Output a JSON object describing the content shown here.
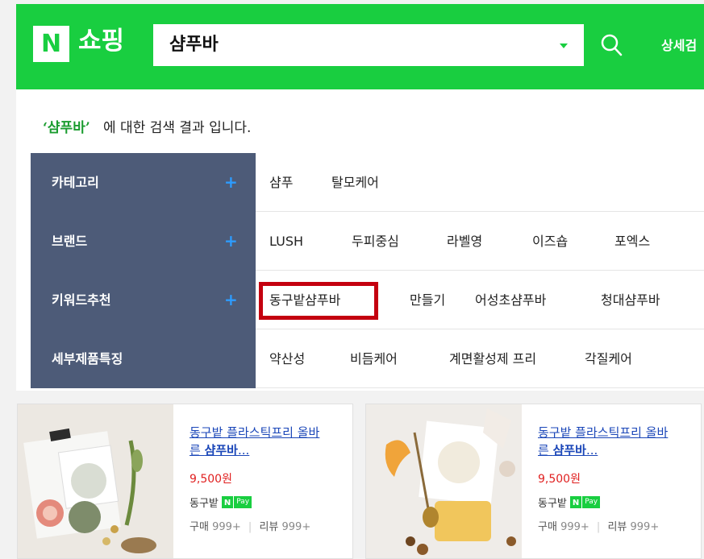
{
  "header": {
    "logo_letter": "N",
    "logo_text": "쇼핑",
    "search_value": "샴푸바",
    "detail_link": "상세검"
  },
  "result_message": {
    "keyword": "‘샴푸바’",
    "suffix": "에 대한 검색 결과 입니다."
  },
  "filter_rows": [
    {
      "label": "카테고리",
      "plus": "+",
      "items": [
        "샴푸",
        "탈모케어"
      ]
    },
    {
      "label": "브랜드",
      "plus": "+",
      "items": [
        "LUSH",
        "두피중심",
        "라벨영",
        "이즈숍",
        "포엑스"
      ]
    },
    {
      "label": "키워드추천",
      "plus": "+",
      "items": [
        "동구밭샴푸바",
        "만들기",
        "어성초샴푸바",
        "청대샴푸바"
      ]
    },
    {
      "label": "세부제품특징",
      "plus": "",
      "items": [
        "약산성",
        "비듬케어",
        "계면활성제 프리",
        "각질케어"
      ]
    }
  ],
  "products": [
    {
      "title_line1": "동구밭 플라스틱프리 올바",
      "title_pre": "른 ",
      "title_bold": "샴푸바",
      "title_post": "...",
      "price": "9,500원",
      "seller": "동구밭",
      "npay_n": "N",
      "npay_pay": "Pay",
      "purchase_label": "구매",
      "purchase_count": "999+",
      "review_label": "리뷰",
      "review_count": "999+"
    },
    {
      "title_line1": "동구밭 플라스틱프리 올바",
      "title_pre": "른 ",
      "title_bold": "샴푸바",
      "title_post": "...",
      "price": "9,500원",
      "seller": "동구밭",
      "npay_n": "N",
      "npay_pay": "Pay",
      "purchase_label": "구매",
      "purchase_count": "999+",
      "review_label": "리뷰",
      "review_count": "999+"
    }
  ],
  "colors": {
    "brand_green": "#19ce40",
    "filter_label_bg": "#4d5b78",
    "highlight_red": "#c4000f",
    "link_blue": "#1a46b8",
    "price_red": "#e02020"
  }
}
